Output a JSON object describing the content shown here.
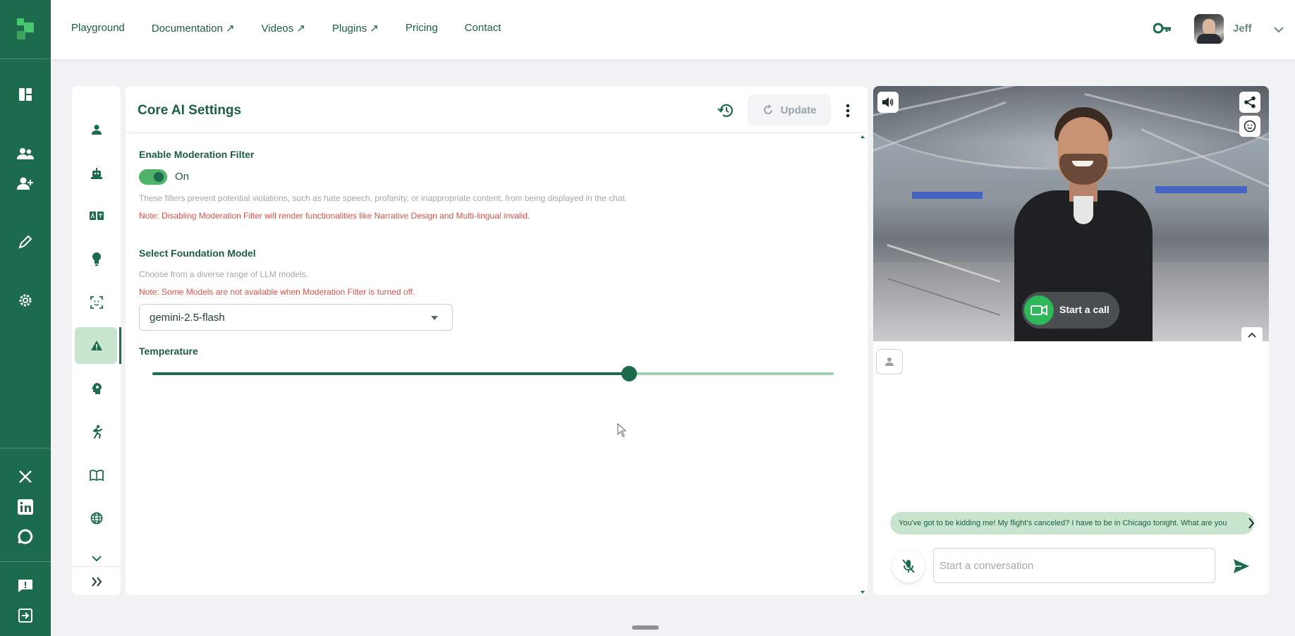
{
  "nav": {
    "items": [
      {
        "label": "Playground"
      },
      {
        "label": "Documentation ↗"
      },
      {
        "label": "Videos ↗"
      },
      {
        "label": "Plugins ↗"
      },
      {
        "label": "Pricing"
      },
      {
        "label": "Contact"
      }
    ]
  },
  "user": {
    "name": "Jeff"
  },
  "rail": {
    "icons": [
      "dashboard-icon",
      "users-icon",
      "add-user-icon",
      "pencil-icon",
      "settings-icon",
      "x-twitter-icon",
      "linkedin-icon",
      "chat-bubble-icon",
      "feedback-icon",
      "logout-icon"
    ]
  },
  "sidebar": {
    "icons": [
      "person-icon",
      "robot-icon",
      "translate-icon",
      "lightbulb-icon",
      "scan-face-icon",
      "warning-icon",
      "head-idea-icon",
      "running-icon",
      "book-icon",
      "globe-icon",
      "chevron-down-icon",
      "double-chevron-right-icon"
    ],
    "active": "warning-icon"
  },
  "settings": {
    "title": "Core AI Settings",
    "update_label": "Update",
    "moderation": {
      "label": "Enable Moderation Filter",
      "state_label": "On",
      "enabled": true,
      "help": "These filters prevent potential violations, such as hate speech, profanity, or inappropriate content, from being displayed in the chat.",
      "note": "Note: Disabling Moderation Filter will render functionalities like Narrative Design and Multi-lingual invalid."
    },
    "model": {
      "label": "Select Foundation Model",
      "help": "Choose from a diverse range of LLM models.",
      "note": "Note: Some Models are not available when Moderation Filter is turned off.",
      "selected": "gemini-2.5-flash"
    },
    "temperature": {
      "label": "Temperature",
      "value_fraction": 0.7
    }
  },
  "panel": {
    "call_label": "Start a call",
    "message": "You've got to be kidding me! My flight's canceled? I have to be in Chicago tonight. What are you",
    "input_placeholder": "Start a conversation"
  },
  "colors": {
    "brand": "#1c6b4c",
    "accent_green": "#46c770",
    "note_red": "#d9534f",
    "bubble": "#c8e6cf"
  }
}
